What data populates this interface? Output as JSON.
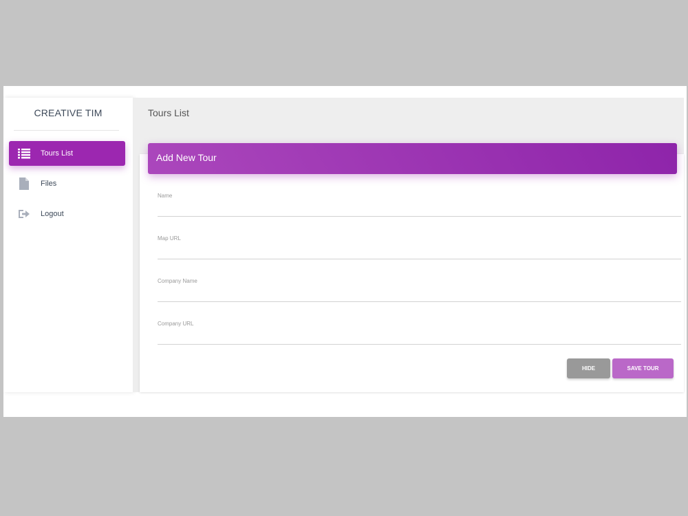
{
  "sidebar": {
    "brand": "CREATIVE TIM",
    "items": [
      {
        "label": "Tours List",
        "icon": "list-icon",
        "active": true
      },
      {
        "label": "Files",
        "icon": "file-icon",
        "active": false
      },
      {
        "label": "Logout",
        "icon": "logout-icon",
        "active": false
      }
    ]
  },
  "header": {
    "title": "Tours List"
  },
  "card": {
    "title": "Add New Tour",
    "fields": [
      {
        "label": "Name",
        "value": ""
      },
      {
        "label": "Map URL",
        "value": ""
      },
      {
        "label": "Company Name",
        "value": ""
      },
      {
        "label": "Company URL",
        "value": ""
      }
    ],
    "hide_label": "HIDE",
    "save_label": "SAVE TOUR"
  },
  "colors": {
    "accent": "#9c27b0",
    "accent_light": "#ba68c8",
    "button_gray": "#999999"
  }
}
